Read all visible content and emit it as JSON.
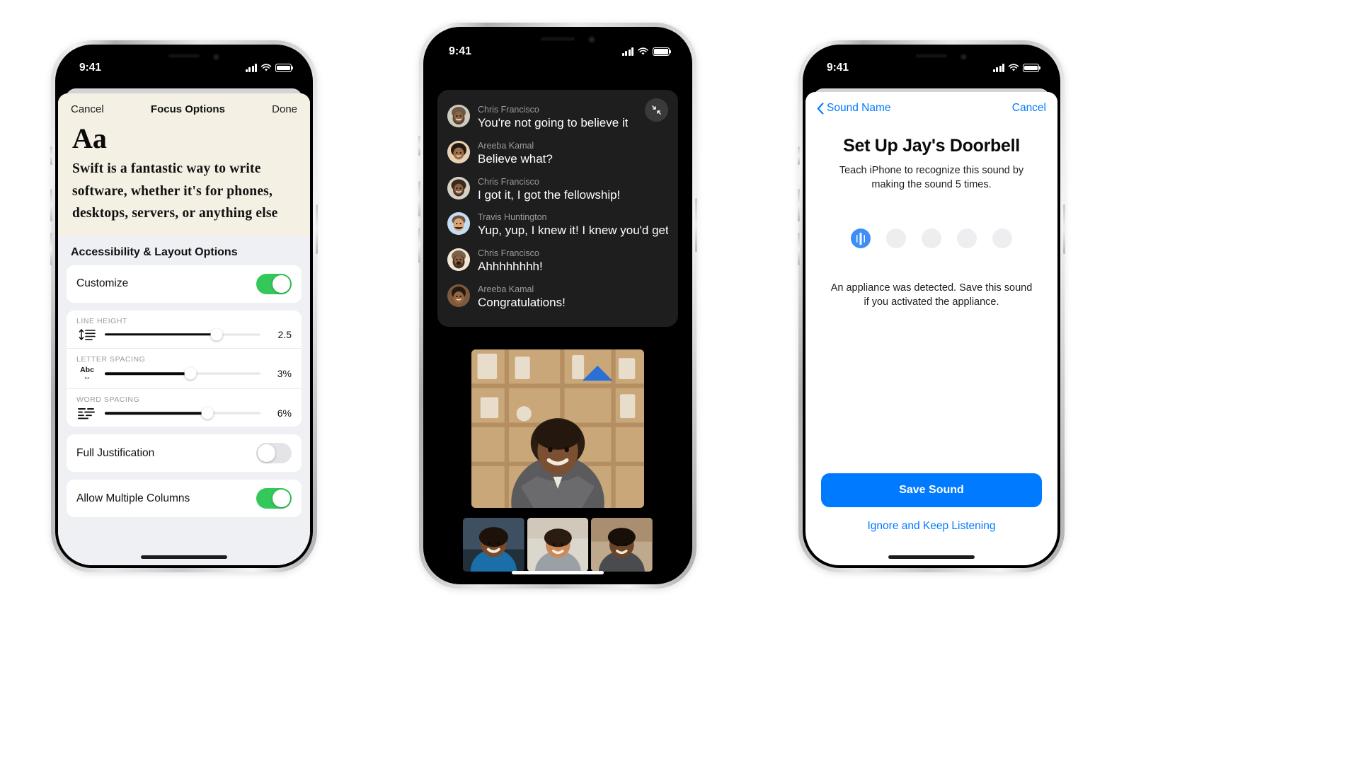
{
  "phone1": {
    "name": "iphone-focus-options",
    "status": {
      "time": "9:41",
      "signal_bars": 4,
      "wifi": "wifi-icon",
      "battery": "battery-icon"
    },
    "navbar": {
      "cancel": "Cancel",
      "title": "Focus Options",
      "done": "Done"
    },
    "preview": {
      "sample_glyph": "Aa",
      "body": "Swift is a fantastic way to write software, whether it's for phones, desktops, servers, or anything else"
    },
    "section_title": "Accessibility & Layout Options",
    "customize": {
      "label": "Customize",
      "enabled": true
    },
    "sliders": [
      {
        "caption": "LINE HEIGHT",
        "icon": "line-height-icon",
        "value": "2.5",
        "percent": 72
      },
      {
        "caption": "LETTER SPACING",
        "icon": "letter-spacing-icon",
        "value": "3%",
        "percent": 55
      },
      {
        "caption": "WORD SPACING",
        "icon": "word-spacing-icon",
        "value": "6%",
        "percent": 66
      }
    ],
    "toggles": [
      {
        "label": "Full Justification",
        "enabled": false
      },
      {
        "label": "Allow Multiple Columns",
        "enabled": true
      }
    ]
  },
  "phone2": {
    "name": "iphone-facetime-live-captions",
    "status": {
      "time": "9:41",
      "signal_bars": 4,
      "wifi": "wifi-icon",
      "battery": "battery-icon"
    },
    "collapse_button": "collapse-icon",
    "captions": [
      {
        "speaker": "Chris Francisco",
        "text": "You're not going to believe it",
        "avatar": "#a9a59e"
      },
      {
        "speaker": "Areeba Kamal",
        "text": "Believe what?",
        "avatar": "#e7c9a6"
      },
      {
        "speaker": "Chris Francisco",
        "text": "I got it, I got the fellowship!",
        "avatar": "#c98a54"
      },
      {
        "speaker": "Travis Huntington",
        "text": "Yup, yup, I knew it! I knew you'd get it",
        "avatar": "#bcd8f0"
      },
      {
        "speaker": "Chris Francisco",
        "text": "Ahhhhhhhh!",
        "avatar": "#efe3cf"
      },
      {
        "speaker": "Areeba Kamal",
        "text": "Congratulations!",
        "avatar": "#6a4b33"
      }
    ],
    "main_tile": "active-speaker-video",
    "thumbnails": [
      "participant-video-1",
      "participant-video-2",
      "participant-video-3"
    ]
  },
  "phone3": {
    "name": "iphone-sound-recognition-setup",
    "status": {
      "time": "9:41",
      "signal_bars": 4,
      "wifi": "wifi-icon",
      "battery": "battery-icon"
    },
    "navbar": {
      "back": "Sound Name",
      "cancel": "Cancel"
    },
    "title": "Set Up Jay's Doorbell",
    "subtitle": "Teach iPhone to recognize this sound by making the sound 5 times.",
    "progress_dots": {
      "total": 5,
      "active_index": 0
    },
    "status_message": "An appliance was detected. Save this sound if you activated the appliance.",
    "save_button": "Save Sound",
    "ignore_link": "Ignore and Keep Listening"
  },
  "colors": {
    "accent_blue": "#007aff",
    "toggle_green": "#34c759",
    "paper_cream": "#f4f1e4",
    "list_gray": "#eef0f4",
    "caption_panel": "#1e1e1f"
  }
}
